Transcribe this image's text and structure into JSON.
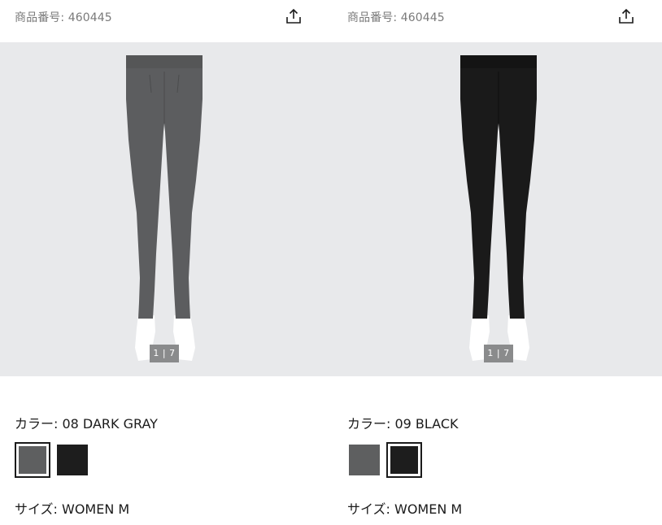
{
  "products": [
    {
      "product_number": "商品番号: 460445",
      "image_counter": "1 | 7",
      "color_label": "カラー: 08 DARK GRAY",
      "size_label": "サイズ: WOMEN M",
      "leggings_color": "#5c5d5f",
      "swatches": [
        {
          "name": "dark-gray",
          "color": "#5e5f60",
          "selected": true
        },
        {
          "name": "black",
          "color": "#1d1d1d",
          "selected": false
        }
      ]
    },
    {
      "product_number": "商品番号: 460445",
      "image_counter": "1 | 7",
      "color_label": "カラー: 09 BLACK",
      "size_label": "サイズ: WOMEN M",
      "leggings_color": "#1a1a1a",
      "swatches": [
        {
          "name": "dark-gray",
          "color": "#5e5f60",
          "selected": false
        },
        {
          "name": "black",
          "color": "#1d1d1d",
          "selected": true
        }
      ]
    }
  ],
  "icons": {
    "share": "share-icon"
  }
}
